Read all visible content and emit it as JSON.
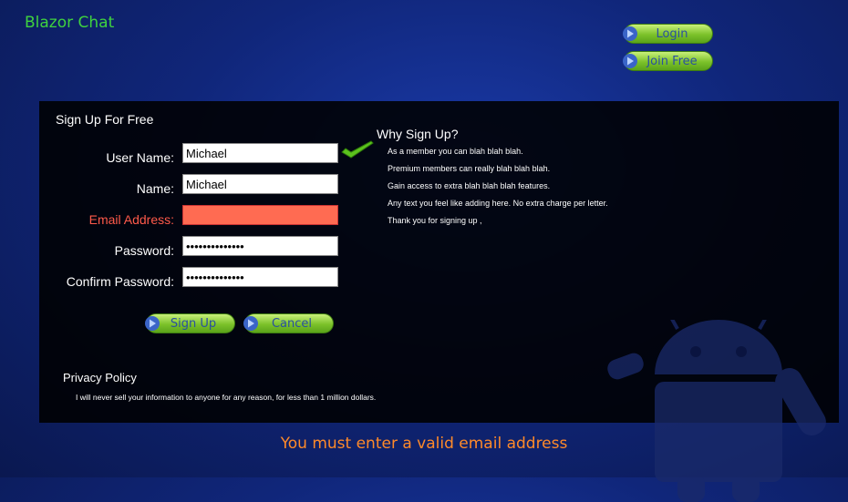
{
  "app": {
    "title": "Blazor Chat"
  },
  "nav": {
    "login_label": "Login",
    "join_label": "Join Free"
  },
  "form": {
    "title": "Sign Up For Free",
    "fields": [
      {
        "label": "User Name:",
        "value": "Michael",
        "type": "text"
      },
      {
        "label": "Name:",
        "value": "Michael",
        "type": "text"
      },
      {
        "label": "Email Address:",
        "value": "",
        "type": "email",
        "error": true
      },
      {
        "label": "Password:",
        "value": "••••••••••••••",
        "type": "password"
      },
      {
        "label": "Confirm Password:",
        "value": "••••••••••••••",
        "type": "password"
      }
    ],
    "signup_label": "Sign Up",
    "cancel_label": "Cancel",
    "username_valid_icon": "checkmark-icon"
  },
  "why": {
    "title": "Why Sign Up?",
    "lines": [
      "As a member you can blah blah blah.",
      "Premium members can really blah blah blah.",
      "Gain access to extra blah blah blah features.",
      "Any text you feel like adding here. No extra charge per letter.",
      "Thank you for signing up ,"
    ]
  },
  "privacy": {
    "title": "Privacy Policy",
    "text": "I will never sell your information to anyone for any reason, for less than 1 million dollars."
  },
  "status": {
    "error_message": "You must enter a valid email address"
  },
  "colors": {
    "brand": "#3fd23f",
    "button_green": "#7cc22a",
    "button_text": "#2a4fa0",
    "error_field": "#ff6b52",
    "error_label": "#ff5a4a",
    "error_message": "#ff8a2a"
  }
}
